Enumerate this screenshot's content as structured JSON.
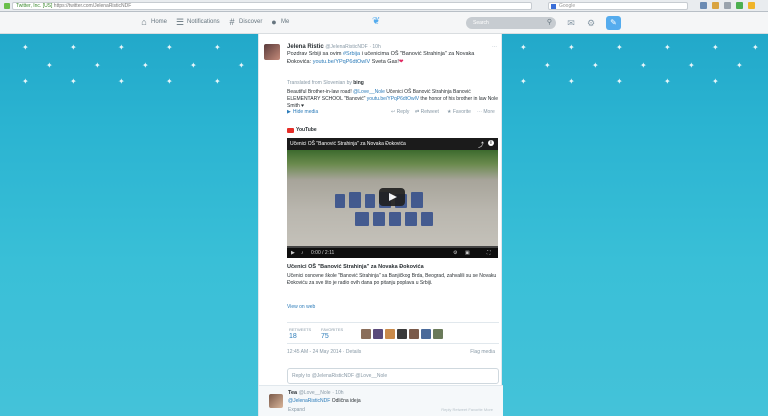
{
  "browser": {
    "url_site": "Twitter, Inc. [US]",
    "url_path": "https://twitter.com/JelenaRisticNDF",
    "search_placeholder": "Google"
  },
  "nav": {
    "home": "Home",
    "notifications": "Notifications",
    "discover": "Discover",
    "me": "Me",
    "search_placeholder": "Search"
  },
  "tweet": {
    "name": "Jelena Ristic",
    "handle": "@JelenaRisticNDF",
    "time": "· 10h",
    "text_before": "Pozdrav Srbiji sa ovim ",
    "link_1": "#Srbija",
    "text_mid": " i učenicima OŠ \"Banović Strahinja\" za Novaka Đokovića: ",
    "link_2": "youtu.be/YPqP6dtOwlV",
    "text_after": " Sveta Gas!",
    "translated_label": "Translated from Slovenian by",
    "translator": "bing",
    "translation_before": "Beautiful Brother-in-law road! ",
    "translation_link_1": "@Love__Nole",
    "translation_mid": " Učenici OŠ Banović Strahinja Banović ELEMENTARY SCHOOL \"Banović\" ",
    "translation_link_2": "youtu.be/YPqP6dtOwlV",
    "translation_after": " the honor of his brother in law Nole Smith ♥",
    "hide_media": "Hide media",
    "reply": "Reply",
    "retweet": "Retweet",
    "favorite": "Favorite",
    "more": "More",
    "more_icon": "⋯"
  },
  "media": {
    "provider": "YouTube",
    "video_title": "Učenici OŠ \"Banović Strahinja\" za Novaka Đokovića",
    "time": "0:00 / 2:11",
    "card_title": "Učenici OŠ \"Banović Strahinja\" za Novaka Đokovića",
    "card_desc": "Učenici osnovne škole \"Banović Strahinja\" sa Banjičkog Brda, Beograd, zahvalili su se Novaku Đokoviću za sve što je radio ovih dana po pitanju poplava u Srbiji.",
    "view_web": "View on web"
  },
  "stats": {
    "retweets_label": "RETWEETS",
    "retweets": "18",
    "favorites_label": "FAVORITES",
    "favorites": "75"
  },
  "meta": {
    "date": "12:45 AM - 24 May 2014 · Details",
    "flag": "Flag media"
  },
  "reply_box": {
    "placeholder": "Reply to @JelenaRisticNDF @Love__Nole"
  },
  "reply_tweet": {
    "name": "Tea",
    "handle": "@Love__Nole",
    "time": "· 10h",
    "mention": "@JelenaRisticNDF",
    "text": " Odlična ideja",
    "expand": "Expand",
    "actions": "Reply   Retweet   Favorite   More"
  },
  "colors": {
    "accent": "#55acee",
    "link": "#2b7bb9",
    "background": "#2ab3d1"
  }
}
